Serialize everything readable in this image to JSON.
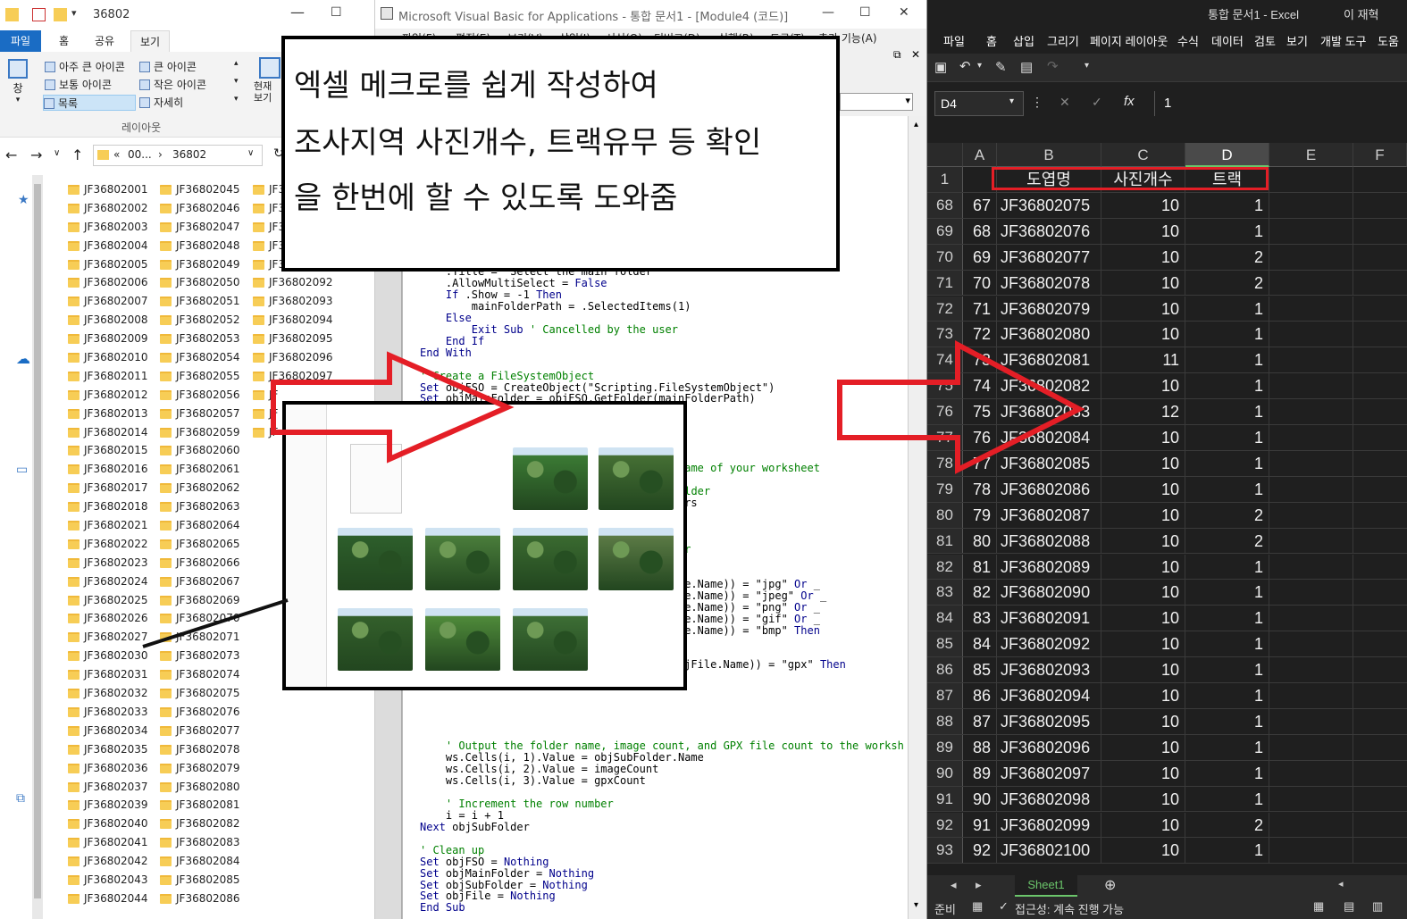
{
  "explorer": {
    "title": "36802",
    "tabs": [
      "파일",
      "홈",
      "공유",
      "보기"
    ],
    "ribbon": {
      "pane_label": "창",
      "views": [
        "아주 큰 아이콘",
        "큰 아이콘",
        "보통 아이콘",
        "작은 아이콘",
        "목록",
        "자세히"
      ],
      "group_label": "레이아웃",
      "current_view_label": "현재\n보기"
    },
    "address": {
      "prefix": "«",
      "crumb1": "00...",
      "crumb2": "36802"
    },
    "folders_col1": [
      "JF36802001",
      "JF36802002",
      "JF36802003",
      "JF36802004",
      "JF36802005",
      "JF36802006",
      "JF36802007",
      "JF36802008",
      "JF36802009",
      "JF36802010",
      "JF36802011",
      "JF36802012",
      "JF36802013",
      "JF36802014",
      "JF36802015",
      "JF36802016",
      "JF36802017",
      "JF36802018",
      "JF36802021",
      "JF36802022",
      "JF36802023",
      "JF36802024",
      "JF36802025",
      "JF36802026",
      "JF36802027",
      "JF36802030",
      "JF36802031",
      "JF36802032",
      "JF36802033",
      "JF36802034",
      "JF36802035",
      "JF36802036",
      "JF36802037",
      "JF36802039",
      "JF36802040",
      "JF36802041",
      "JF36802042",
      "JF36802043",
      "JF36802044"
    ],
    "folders_col2": [
      "JF36802045",
      "JF36802046",
      "JF36802047",
      "JF36802048",
      "JF36802049",
      "JF36802050",
      "JF36802051",
      "JF36802052",
      "JF36802053",
      "JF36802054",
      "JF36802055",
      "JF36802056",
      "JF36802057",
      "JF36802059",
      "JF36802060",
      "JF36802061",
      "JF36802062",
      "JF36802063",
      "JF36802064",
      "JF36802065",
      "JF36802066",
      "JF36802067",
      "JF36802069",
      "JF36802070",
      "JF36802071",
      "JF36802073",
      "JF36802074",
      "JF36802075",
      "JF36802076",
      "JF36802077",
      "JF36802078",
      "JF36802079",
      "JF36802080",
      "JF36802081",
      "JF36802082",
      "JF36802083",
      "JF36802084",
      "JF36802085",
      "JF36802086"
    ],
    "folders_col3": [
      "JF3",
      "JF3",
      "JF3",
      "JF3",
      "JF3",
      "JF36802092",
      "JF36802093",
      "JF36802094",
      "JF36802095",
      "JF36802096",
      "JF36802097",
      "JF",
      "JF",
      "JF"
    ]
  },
  "vba": {
    "title": "Microsoft Visual Basic for Applications - 통합 문서1 - [Module4 (코드)]",
    "menu": [
      "파일(F)",
      "편집(E)",
      "보기(V)",
      "삽입(I)",
      "서식(O)",
      "디버그(D)",
      "실행(R)",
      "도구(T)",
      "추가 기능(A)"
    ]
  },
  "excel": {
    "title": "통합 문서1 - Excel",
    "user": "이 재혁",
    "tabs": [
      "파일",
      "홈",
      "삽입",
      "그리기",
      "페이지 레이아웃",
      "수식",
      "데이터",
      "검토",
      "보기",
      "개발 도구",
      "도움"
    ],
    "name_box": "D4",
    "formula_value": "1",
    "columns": [
      "A",
      "B",
      "C",
      "D",
      "E",
      "F"
    ],
    "header_row": {
      "row": "1",
      "b": "도엽명",
      "c": "사진개수",
      "d": "트랙"
    },
    "rows": [
      {
        "r": "68",
        "a": "67",
        "b": "JF36802075",
        "c": "10",
        "d": "1"
      },
      {
        "r": "69",
        "a": "68",
        "b": "JF36802076",
        "c": "10",
        "d": "1"
      },
      {
        "r": "70",
        "a": "69",
        "b": "JF36802077",
        "c": "10",
        "d": "2"
      },
      {
        "r": "71",
        "a": "70",
        "b": "JF36802078",
        "c": "10",
        "d": "2"
      },
      {
        "r": "72",
        "a": "71",
        "b": "JF36802079",
        "c": "10",
        "d": "1"
      },
      {
        "r": "73",
        "a": "72",
        "b": "JF36802080",
        "c": "10",
        "d": "1"
      },
      {
        "r": "74",
        "a": "73",
        "b": "JF36802081",
        "c": "11",
        "d": "1"
      },
      {
        "r": "75",
        "a": "74",
        "b": "JF36802082",
        "c": "10",
        "d": "1"
      },
      {
        "r": "76",
        "a": "75",
        "b": "JF36802083",
        "c": "12",
        "d": "1"
      },
      {
        "r": "77",
        "a": "76",
        "b": "JF36802084",
        "c": "10",
        "d": "1"
      },
      {
        "r": "78",
        "a": "77",
        "b": "JF36802085",
        "c": "10",
        "d": "1"
      },
      {
        "r": "79",
        "a": "78",
        "b": "JF36802086",
        "c": "10",
        "d": "1"
      },
      {
        "r": "80",
        "a": "79",
        "b": "JF36802087",
        "c": "10",
        "d": "2"
      },
      {
        "r": "81",
        "a": "80",
        "b": "JF36802088",
        "c": "10",
        "d": "2"
      },
      {
        "r": "82",
        "a": "81",
        "b": "JF36802089",
        "c": "10",
        "d": "1"
      },
      {
        "r": "83",
        "a": "82",
        "b": "JF36802090",
        "c": "10",
        "d": "1"
      },
      {
        "r": "84",
        "a": "83",
        "b": "JF36802091",
        "c": "10",
        "d": "1"
      },
      {
        "r": "85",
        "a": "84",
        "b": "JF36802092",
        "c": "10",
        "d": "1"
      },
      {
        "r": "86",
        "a": "85",
        "b": "JF36802093",
        "c": "10",
        "d": "1"
      },
      {
        "r": "87",
        "a": "86",
        "b": "JF36802094",
        "c": "10",
        "d": "1"
      },
      {
        "r": "88",
        "a": "87",
        "b": "JF36802095",
        "c": "10",
        "d": "1"
      },
      {
        "r": "89",
        "a": "88",
        "b": "JF36802096",
        "c": "10",
        "d": "1"
      },
      {
        "r": "90",
        "a": "89",
        "b": "JF36802097",
        "c": "10",
        "d": "1"
      },
      {
        "r": "91",
        "a": "90",
        "b": "JF36802098",
        "c": "10",
        "d": "1"
      },
      {
        "r": "92",
        "a": "91",
        "b": "JF36802099",
        "c": "10",
        "d": "2"
      },
      {
        "r": "93",
        "a": "92",
        "b": "JF36802100",
        "c": "10",
        "d": "1"
      }
    ],
    "sheet_tab": "Sheet1",
    "status_ready": "준비",
    "status_accessibility": "접근성: 계속 진행 가능"
  },
  "overlay": {
    "note_lines": [
      "엑셀 메크로를 쉽게 작성하여",
      "조사지역 사진개수, 트랙유무 등 확인",
      "을 한번에 할 수 있도록 도와줌"
    ]
  },
  "colors": {
    "arrow_red": "#e41e26",
    "excel_bg": "#1f1f1f",
    "explorer_file_tab": "#1a6cc4",
    "folder_yellow": "#f7cd56",
    "vba_keyword": "#00008b",
    "vba_comment": "#008000"
  }
}
